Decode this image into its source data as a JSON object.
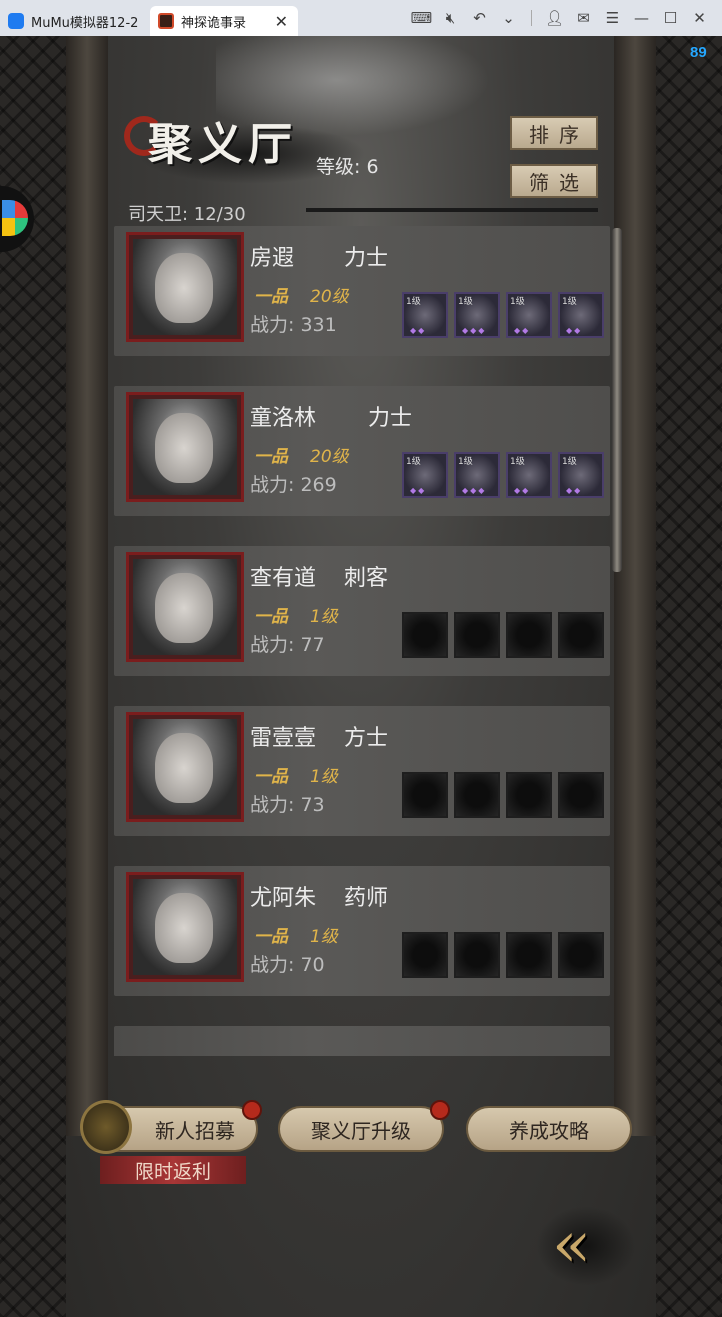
{
  "window": {
    "tabs": [
      {
        "label": "MuMu模拟器12-2",
        "icon": "mumu-logo-icon"
      },
      {
        "label": "神探诡事录",
        "icon": "game-icon"
      }
    ],
    "fps": "89"
  },
  "hall": {
    "title": "聚义厅",
    "level_text": "等级: 6",
    "guard_text": "司天卫: 12/30",
    "sort_label": "排序",
    "filter_label": "筛选"
  },
  "members": [
    {
      "name": "房遐",
      "role": "力士",
      "rank": "一品",
      "level": "20级",
      "power": "战力: 331",
      "equips": [
        {
          "lv": "1级",
          "filled": true
        },
        {
          "lv": "1级",
          "filled": true
        },
        {
          "lv": "1级",
          "filled": true
        },
        {
          "lv": "1级",
          "filled": true
        }
      ]
    },
    {
      "name": "童洛林",
      "role": "力士",
      "rank": "一品",
      "level": "20级",
      "power": "战力: 269",
      "equips": [
        {
          "lv": "1级",
          "filled": true
        },
        {
          "lv": "1级",
          "filled": true
        },
        {
          "lv": "1级",
          "filled": true
        },
        {
          "lv": "1级",
          "filled": true
        }
      ]
    },
    {
      "name": "查有道",
      "role": "刺客",
      "rank": "一品",
      "level": "1级",
      "power": "战力: 77",
      "equips": [
        {
          "lv": "",
          "filled": false
        },
        {
          "lv": "",
          "filled": false
        },
        {
          "lv": "",
          "filled": false
        },
        {
          "lv": "",
          "filled": false
        }
      ]
    },
    {
      "name": "雷壹壹",
      "role": "方士",
      "rank": "一品",
      "level": "1级",
      "power": "战力: 73",
      "equips": [
        {
          "lv": "",
          "filled": false
        },
        {
          "lv": "",
          "filled": false
        },
        {
          "lv": "",
          "filled": false
        },
        {
          "lv": "",
          "filled": false
        }
      ]
    },
    {
      "name": "尤阿朱",
      "role": "药师",
      "rank": "一品",
      "level": "1级",
      "power": "战力: 70",
      "equips": [
        {
          "lv": "",
          "filled": false
        },
        {
          "lv": "",
          "filled": false
        },
        {
          "lv": "",
          "filled": false
        },
        {
          "lv": "",
          "filled": false
        }
      ]
    }
  ],
  "bottom": {
    "recruit_label": "新人招募",
    "upgrade_label": "聚义厅升级",
    "guide_label": "养成攻略",
    "limited_label": "限时返利",
    "back_icon": "double-chevron-left-icon"
  },
  "colors": {
    "accent_gold": "#e0b44a",
    "badge_red": "#b52a1c",
    "fps_blue": "#25a7ff"
  }
}
